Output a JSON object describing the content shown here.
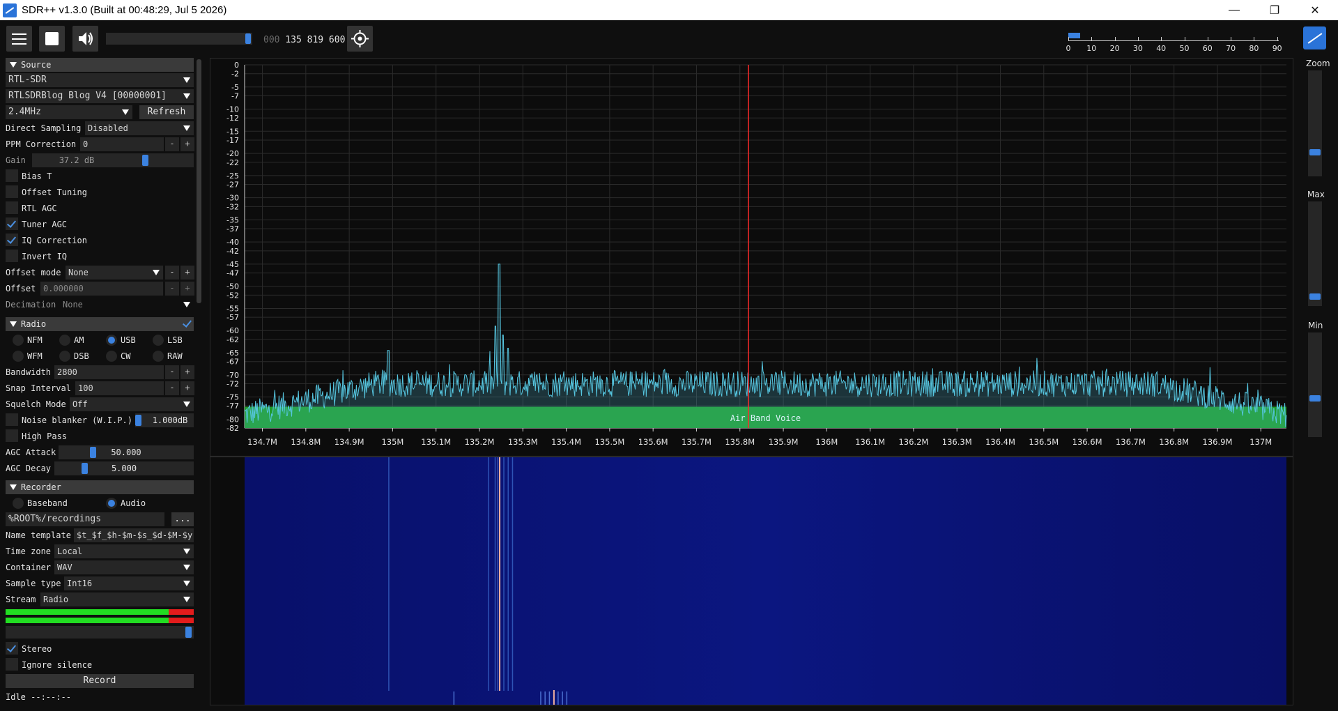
{
  "window": {
    "title": "SDR++ v1.3.0 (Built at 00:48:29, Jul  5 2026)",
    "minimize": "—",
    "maximize": "❐",
    "close": "✕"
  },
  "toolbar": {
    "freq_dim": "000",
    "freq_main": "135 819 600",
    "volume_level": 0.97,
    "snr_ticks": [
      "0",
      "10",
      "20",
      "30",
      "40",
      "50",
      "60",
      "70",
      "80",
      "90"
    ]
  },
  "source": {
    "header": "Source",
    "device_type": "RTL-SDR",
    "device": "RTLSDRBlog Blog V4 [00000001]",
    "samplerate": "2.4MHz",
    "refresh": "Refresh",
    "direct_sampling_label": "Direct Sampling",
    "direct_sampling_value": "Disabled",
    "ppm_label": "PPM Correction",
    "ppm_value": "0",
    "gain_label": "Gain",
    "gain_value": "37.2 dB",
    "bias_t": "Bias T",
    "offset_tuning": "Offset Tuning",
    "rtl_agc": "RTL AGC",
    "tuner_agc": "Tuner AGC",
    "iq_correction": "IQ Correction",
    "invert_iq": "Invert IQ",
    "offset_mode_label": "Offset mode",
    "offset_mode_value": "None",
    "offset_label": "Offset",
    "offset_value": "0.000000",
    "decimation_label": "Decimation",
    "decimation_value": "None",
    "minus": "-",
    "plus": "+"
  },
  "radio": {
    "header": "Radio",
    "modes": [
      "NFM",
      "AM",
      "USB",
      "LSB",
      "WFM",
      "DSB",
      "CW",
      "RAW"
    ],
    "selected_mode": "USB",
    "bandwidth_label": "Bandwidth",
    "bandwidth_value": "2800",
    "snap_label": "Snap Interval",
    "snap_value": "100",
    "squelch_label": "Squelch Mode",
    "squelch_value": "Off",
    "noise_blanker_label": "Noise blanker (W.I.P.)",
    "noise_blanker_value": "1.000dB",
    "high_pass": "High Pass",
    "agc_attack_label": "AGC Attack",
    "agc_attack_value": "50.000",
    "agc_decay_label": "AGC Decay",
    "agc_decay_value": "5.000"
  },
  "recorder": {
    "header": "Recorder",
    "baseband": "Baseband",
    "audio": "Audio",
    "path": "%ROOT%/recordings",
    "browse": "...",
    "name_template_label": "Name template",
    "name_template_value": "$t_$f_$h-$m-$s_$d-$M-$y",
    "timezone_label": "Time zone",
    "timezone_value": "Local",
    "container_label": "Container",
    "container_value": "WAV",
    "sample_type_label": "Sample type",
    "sample_type_value": "Int16",
    "stream_label": "Stream",
    "stream_value": "Radio",
    "stereo": "Stereo",
    "ignore_silence": "Ignore silence",
    "record_button": "Record",
    "status": "Idle --:--:--"
  },
  "right_panel": {
    "zoom": "Zoom",
    "max": "Max",
    "min": "Min",
    "zoom_level": 0.2,
    "max_level": 0.05,
    "min_level": 0.35
  },
  "fft": {
    "band_label": "Air Band Voice",
    "y_ticks": [
      "0",
      "-2",
      "-5",
      "-7",
      "-10",
      "-12",
      "-15",
      "-17",
      "-20",
      "-22",
      "-25",
      "-27",
      "-30",
      "-32",
      "-35",
      "-37",
      "-40",
      "-42",
      "-45",
      "-47",
      "-50",
      "-52",
      "-55",
      "-57",
      "-60",
      "-62",
      "-65",
      "-67",
      "-70",
      "-72",
      "-75",
      "-77",
      "-80",
      "-82"
    ],
    "x_ticks": [
      "134.7M",
      "134.8M",
      "134.9M",
      "135M",
      "135.1M",
      "135.2M",
      "135.3M",
      "135.4M",
      "135.5M",
      "135.6M",
      "135.7M",
      "135.8M",
      "135.9M",
      "136M",
      "136.1M",
      "136.2M",
      "136.3M",
      "136.4M",
      "136.5M",
      "136.6M",
      "136.7M",
      "136.8M",
      "136.9M",
      "137M"
    ],
    "center_freq_mhz": 135.8196,
    "peak_freq_mhz": 135.245,
    "peak_db": -45
  },
  "colors": {
    "accent": "#3b82e0",
    "fft_line": "#56c6e0",
    "band": "#1e9b28",
    "vfo_line": "#ff2a2a",
    "waterfall": "#0a1272"
  }
}
